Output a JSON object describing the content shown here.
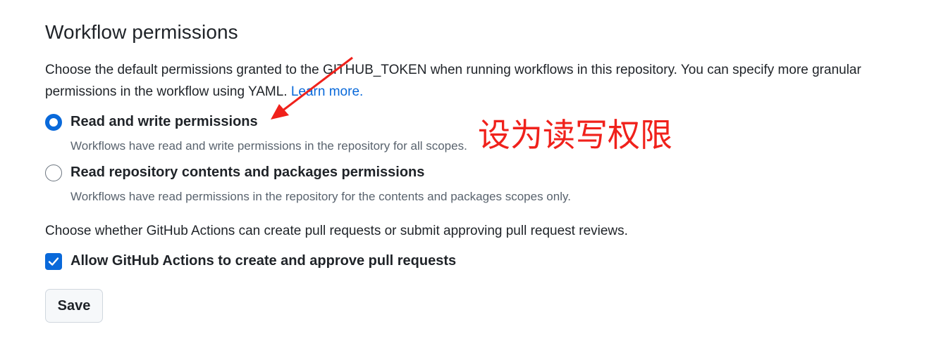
{
  "section": {
    "title": "Workflow permissions",
    "description": "Choose the default permissions granted to the GITHUB_TOKEN when running workflows in this repository. You can specify more granular permissions in the workflow using YAML.",
    "learn_more": "Learn more."
  },
  "options": [
    {
      "label": "Read and write permissions",
      "note": "Workflows have read and write permissions in the repository for all scopes.",
      "selected": true
    },
    {
      "label": "Read repository contents and packages permissions",
      "note": "Workflows have read permissions in the repository for the contents and packages scopes only.",
      "selected": false
    }
  ],
  "pr_section": {
    "description": "Choose whether GitHub Actions can create pull requests or submit approving pull request reviews.",
    "checkbox_label": "Allow GitHub Actions to create and approve pull requests",
    "checked": true
  },
  "save_label": "Save",
  "annotation": {
    "text": "设为读写权限",
    "color": "#f0211b"
  },
  "colors": {
    "accent": "#0969da",
    "muted": "#59636e",
    "text": "#1f2328"
  }
}
